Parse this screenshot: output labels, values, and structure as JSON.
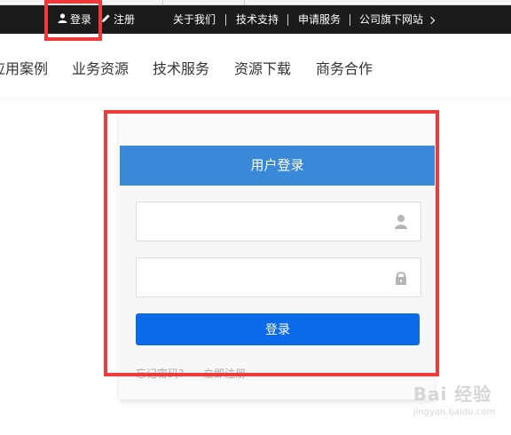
{
  "topbar": {
    "login": "登录",
    "register": "注册",
    "about": "关于我们",
    "support": "技术支持",
    "apply": "申请服务",
    "sites": "公司旗下网站"
  },
  "nav": {
    "items": [
      "应用案例",
      "业务资源",
      "技术服务",
      "资源下载",
      "商务合作"
    ]
  },
  "login_panel": {
    "title": "用户登录",
    "username_value": "",
    "password_value": "",
    "submit_label": "登录",
    "forgot": "忘记密码?",
    "register_now": "立即注册"
  },
  "watermark": {
    "main": "Bai 经验",
    "sub": "jingyan.baidu.com"
  },
  "colors": {
    "topbar_bg": "#1b1b1b",
    "panel_header": "#3a88d8",
    "button": "#0b6aea",
    "annotation": "#f03a3a"
  }
}
